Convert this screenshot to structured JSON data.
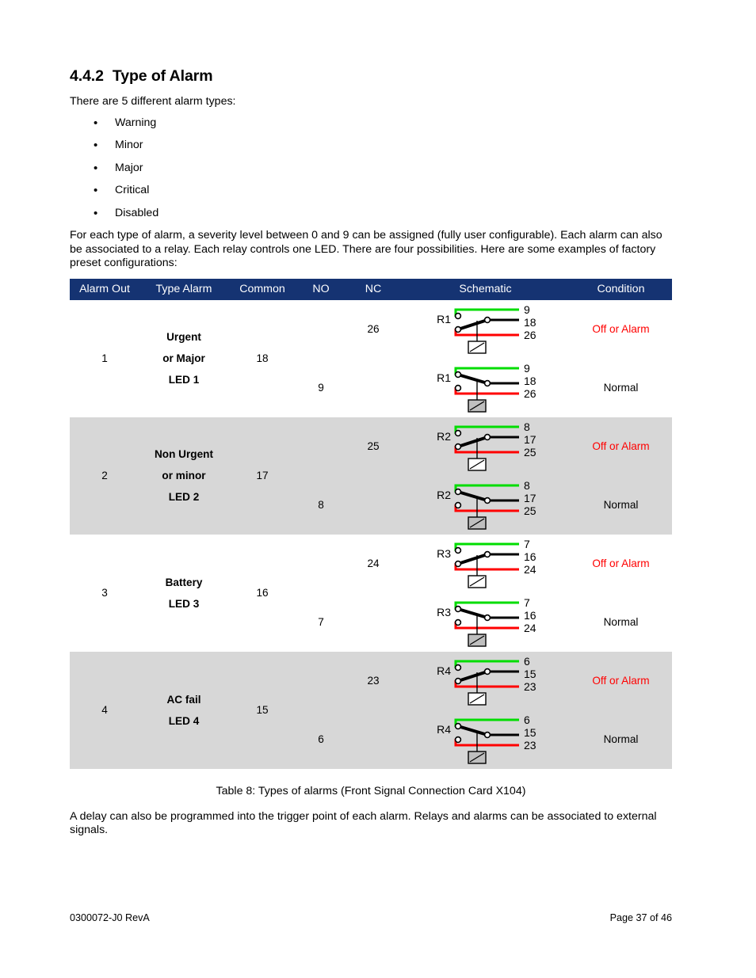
{
  "document": {
    "heading_number": "4.4.2",
    "heading_title": "Type of Alarm",
    "intro": "There are 5 different alarm types:",
    "alarm_types": [
      "Warning",
      "Minor",
      "Major",
      "Critical",
      "Disabled"
    ],
    "bullet_glyph": "•",
    "lead_paragraph": "For each type of alarm, a severity level between 0 and 9 can be assigned (fully user configurable). Each alarm can also be associated to a relay. Each relay controls one LED. There are four possibilities. Here are some examples of factory preset configurations:",
    "caption": "Table 8: Types of alarms (Front Signal Connection Card X104)",
    "closing_paragraph": "A delay can also be programmed into the trigger point of each alarm. Relays and alarms can be associated to external signals."
  },
  "table": {
    "headers": [
      "Alarm Out",
      "Type Alarm",
      "Common",
      "NO",
      "NC",
      "Schematic",
      "Condition"
    ],
    "header_bg": "#153372",
    "header_text_color": "#ffffff",
    "shaded_row_bg": "#d7d7d7",
    "alarm_text_color": "#ff0000",
    "normal_text_color": "#000000",
    "wire_colors": {
      "nc_top": "#00dd00",
      "common_middle": "#000000",
      "no_bottom": "#ff0000"
    },
    "condition_labels": {
      "alarm": "Off or Alarm",
      "normal": "Normal"
    },
    "rows": [
      {
        "alarm_out": "1",
        "type_lines": [
          "Urgent",
          "or Major",
          "LED 1"
        ],
        "common": "18",
        "no": "9",
        "nc": "26",
        "relay": "R1",
        "terminal_top": "9",
        "terminal_mid": "18",
        "terminal_bottom": "26",
        "shaded": false
      },
      {
        "alarm_out": "2",
        "type_lines": [
          "Non Urgent",
          "or minor",
          "LED 2"
        ],
        "common": "17",
        "no": "8",
        "nc": "25",
        "relay": "R2",
        "terminal_top": "8",
        "terminal_mid": "17",
        "terminal_bottom": "25",
        "shaded": true
      },
      {
        "alarm_out": "3",
        "type_lines": [
          "Battery",
          "LED 3"
        ],
        "common": "16",
        "no": "7",
        "nc": "24",
        "relay": "R3",
        "terminal_top": "7",
        "terminal_mid": "16",
        "terminal_bottom": "24",
        "shaded": false
      },
      {
        "alarm_out": "4",
        "type_lines": [
          "AC fail",
          "LED 4"
        ],
        "common": "15",
        "no": "6",
        "nc": "23",
        "relay": "R4",
        "terminal_top": "6",
        "terminal_mid": "15",
        "terminal_bottom": "23",
        "shaded": true
      }
    ]
  },
  "footer": {
    "doc_id": "0300072-J0 RevA",
    "page_label": "Page 37 of 46"
  }
}
